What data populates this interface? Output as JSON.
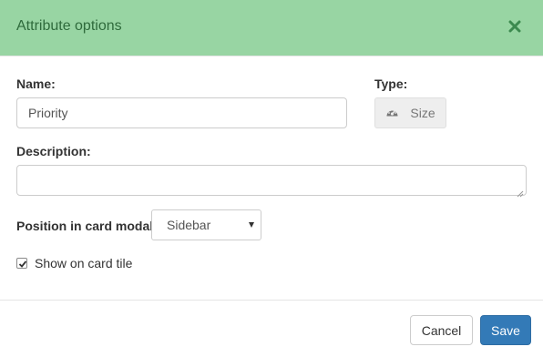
{
  "header": {
    "title": "Attribute options",
    "accent_color": "#98d5a3",
    "close_icon": "close-x"
  },
  "form": {
    "name_label": "Name:",
    "name_value": "Priority",
    "type_label": "Type:",
    "type_value": "Size",
    "type_icon": "dashboard-gauge",
    "description_label": "Description:",
    "description_value": "",
    "position_label": "Position in card modal:",
    "position_value": "Sidebar",
    "show_on_tile_label": "Show on card tile",
    "show_on_tile_checked": true
  },
  "footer": {
    "cancel_label": "Cancel",
    "save_label": "Save",
    "save_color": "#337ab7"
  }
}
